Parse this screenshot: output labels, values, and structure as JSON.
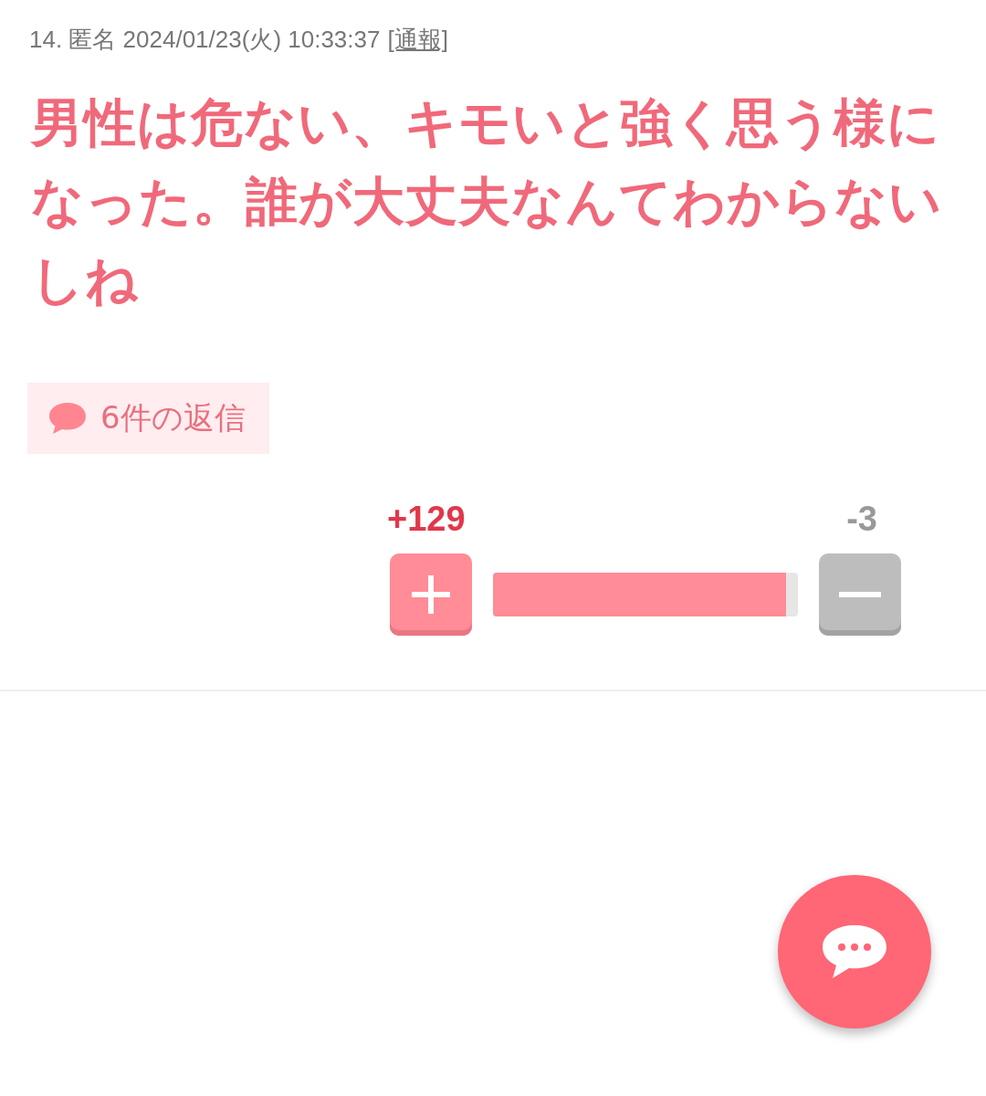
{
  "comment": {
    "meta": "14. 匿名 2024/01/23(火) 10:33:37",
    "report_link": "[通報]",
    "body": "男性は危ない、キモいと強く思う様になった。誰が大丈夫なんてわからないしね",
    "replies": "6件の返信",
    "votes": {
      "plus": "+129",
      "minus": "-3",
      "level": 0.96
    }
  }
}
